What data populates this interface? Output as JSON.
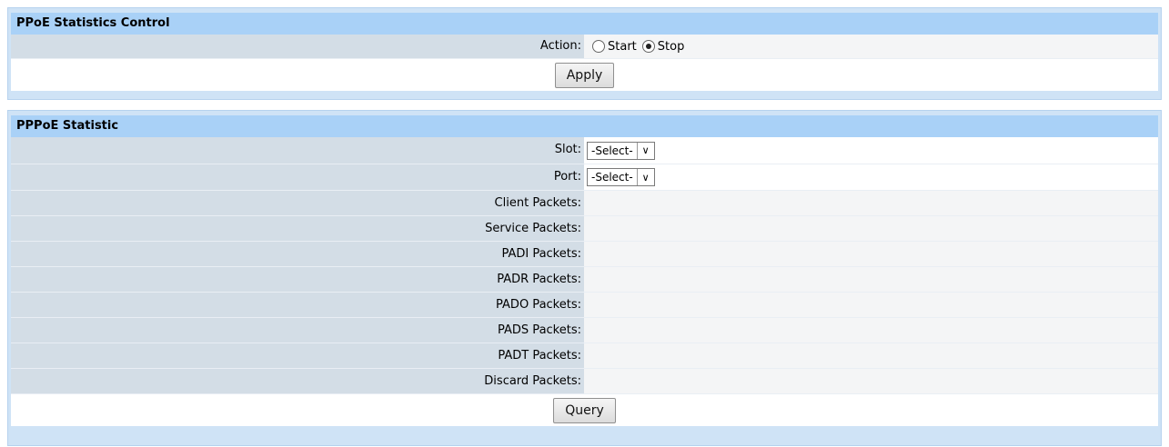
{
  "control": {
    "title": "PPoE Statistics Control",
    "action_label": "Action:",
    "start_label": "Start",
    "stop_label": "Stop",
    "selected": "Stop",
    "apply_label": "Apply"
  },
  "stats": {
    "title": "PPPoE Statistic",
    "slot_label": "Slot:",
    "slot_value": "-Select-",
    "port_label": "Port:",
    "port_value": "-Select-",
    "rows": [
      {
        "label": "Client Packets:"
      },
      {
        "label": "Service Packets:"
      },
      {
        "label": "PADI Packets:"
      },
      {
        "label": "PADR Packets:"
      },
      {
        "label": "PADO Packets:"
      },
      {
        "label": "PADS Packets:"
      },
      {
        "label": "PADT Packets:"
      },
      {
        "label": "Discard Packets:"
      }
    ],
    "query_label": "Query"
  }
}
